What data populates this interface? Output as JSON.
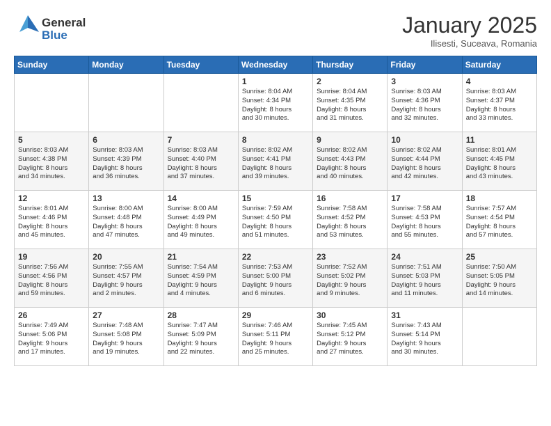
{
  "header": {
    "logo_general": "General",
    "logo_blue": "Blue",
    "title": "January 2025",
    "location": "Ilisesti, Suceava, Romania"
  },
  "days_of_week": [
    "Sunday",
    "Monday",
    "Tuesday",
    "Wednesday",
    "Thursday",
    "Friday",
    "Saturday"
  ],
  "weeks": [
    [
      {
        "day": "",
        "info": ""
      },
      {
        "day": "",
        "info": ""
      },
      {
        "day": "",
        "info": ""
      },
      {
        "day": "1",
        "info": "Sunrise: 8:04 AM\nSunset: 4:34 PM\nDaylight: 8 hours\nand 30 minutes."
      },
      {
        "day": "2",
        "info": "Sunrise: 8:04 AM\nSunset: 4:35 PM\nDaylight: 8 hours\nand 31 minutes."
      },
      {
        "day": "3",
        "info": "Sunrise: 8:03 AM\nSunset: 4:36 PM\nDaylight: 8 hours\nand 32 minutes."
      },
      {
        "day": "4",
        "info": "Sunrise: 8:03 AM\nSunset: 4:37 PM\nDaylight: 8 hours\nand 33 minutes."
      }
    ],
    [
      {
        "day": "5",
        "info": "Sunrise: 8:03 AM\nSunset: 4:38 PM\nDaylight: 8 hours\nand 34 minutes."
      },
      {
        "day": "6",
        "info": "Sunrise: 8:03 AM\nSunset: 4:39 PM\nDaylight: 8 hours\nand 36 minutes."
      },
      {
        "day": "7",
        "info": "Sunrise: 8:03 AM\nSunset: 4:40 PM\nDaylight: 8 hours\nand 37 minutes."
      },
      {
        "day": "8",
        "info": "Sunrise: 8:02 AM\nSunset: 4:41 PM\nDaylight: 8 hours\nand 39 minutes."
      },
      {
        "day": "9",
        "info": "Sunrise: 8:02 AM\nSunset: 4:43 PM\nDaylight: 8 hours\nand 40 minutes."
      },
      {
        "day": "10",
        "info": "Sunrise: 8:02 AM\nSunset: 4:44 PM\nDaylight: 8 hours\nand 42 minutes."
      },
      {
        "day": "11",
        "info": "Sunrise: 8:01 AM\nSunset: 4:45 PM\nDaylight: 8 hours\nand 43 minutes."
      }
    ],
    [
      {
        "day": "12",
        "info": "Sunrise: 8:01 AM\nSunset: 4:46 PM\nDaylight: 8 hours\nand 45 minutes."
      },
      {
        "day": "13",
        "info": "Sunrise: 8:00 AM\nSunset: 4:48 PM\nDaylight: 8 hours\nand 47 minutes."
      },
      {
        "day": "14",
        "info": "Sunrise: 8:00 AM\nSunset: 4:49 PM\nDaylight: 8 hours\nand 49 minutes."
      },
      {
        "day": "15",
        "info": "Sunrise: 7:59 AM\nSunset: 4:50 PM\nDaylight: 8 hours\nand 51 minutes."
      },
      {
        "day": "16",
        "info": "Sunrise: 7:58 AM\nSunset: 4:52 PM\nDaylight: 8 hours\nand 53 minutes."
      },
      {
        "day": "17",
        "info": "Sunrise: 7:58 AM\nSunset: 4:53 PM\nDaylight: 8 hours\nand 55 minutes."
      },
      {
        "day": "18",
        "info": "Sunrise: 7:57 AM\nSunset: 4:54 PM\nDaylight: 8 hours\nand 57 minutes."
      }
    ],
    [
      {
        "day": "19",
        "info": "Sunrise: 7:56 AM\nSunset: 4:56 PM\nDaylight: 8 hours\nand 59 minutes."
      },
      {
        "day": "20",
        "info": "Sunrise: 7:55 AM\nSunset: 4:57 PM\nDaylight: 9 hours\nand 2 minutes."
      },
      {
        "day": "21",
        "info": "Sunrise: 7:54 AM\nSunset: 4:59 PM\nDaylight: 9 hours\nand 4 minutes."
      },
      {
        "day": "22",
        "info": "Sunrise: 7:53 AM\nSunset: 5:00 PM\nDaylight: 9 hours\nand 6 minutes."
      },
      {
        "day": "23",
        "info": "Sunrise: 7:52 AM\nSunset: 5:02 PM\nDaylight: 9 hours\nand 9 minutes."
      },
      {
        "day": "24",
        "info": "Sunrise: 7:51 AM\nSunset: 5:03 PM\nDaylight: 9 hours\nand 11 minutes."
      },
      {
        "day": "25",
        "info": "Sunrise: 7:50 AM\nSunset: 5:05 PM\nDaylight: 9 hours\nand 14 minutes."
      }
    ],
    [
      {
        "day": "26",
        "info": "Sunrise: 7:49 AM\nSunset: 5:06 PM\nDaylight: 9 hours\nand 17 minutes."
      },
      {
        "day": "27",
        "info": "Sunrise: 7:48 AM\nSunset: 5:08 PM\nDaylight: 9 hours\nand 19 minutes."
      },
      {
        "day": "28",
        "info": "Sunrise: 7:47 AM\nSunset: 5:09 PM\nDaylight: 9 hours\nand 22 minutes."
      },
      {
        "day": "29",
        "info": "Sunrise: 7:46 AM\nSunset: 5:11 PM\nDaylight: 9 hours\nand 25 minutes."
      },
      {
        "day": "30",
        "info": "Sunrise: 7:45 AM\nSunset: 5:12 PM\nDaylight: 9 hours\nand 27 minutes."
      },
      {
        "day": "31",
        "info": "Sunrise: 7:43 AM\nSunset: 5:14 PM\nDaylight: 9 hours\nand 30 minutes."
      },
      {
        "day": "",
        "info": ""
      }
    ]
  ]
}
